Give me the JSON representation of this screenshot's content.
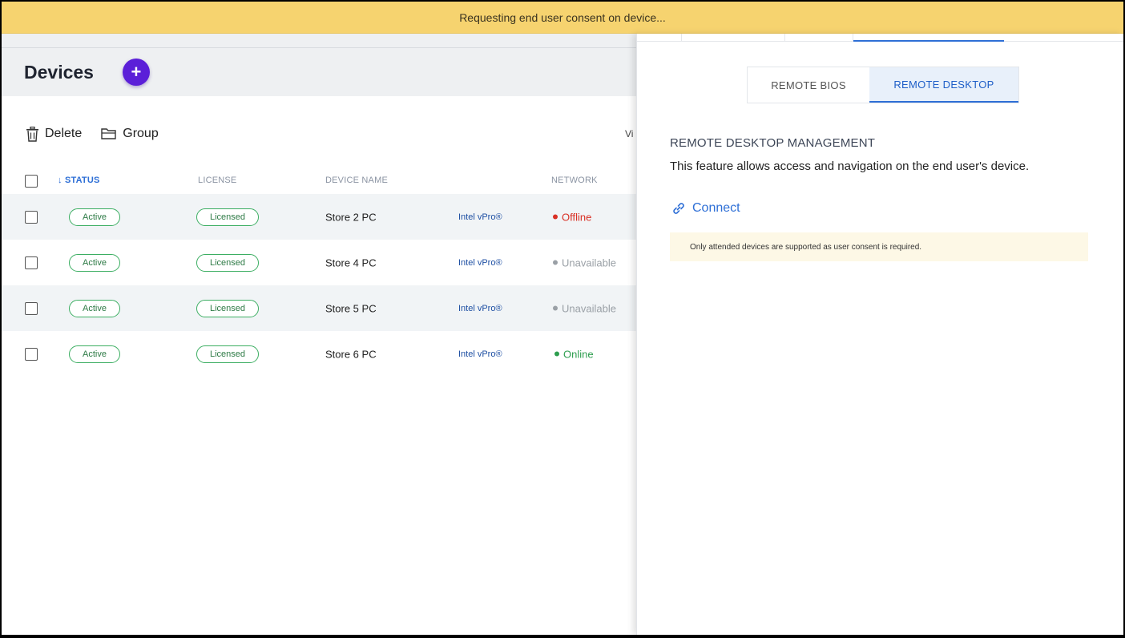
{
  "banner": {
    "text": "Requesting end user consent on device..."
  },
  "page": {
    "title": "Devices",
    "add_label": "+"
  },
  "toolbar": {
    "delete_label": "Delete",
    "group_label": "Group",
    "view_label": "Vi"
  },
  "table": {
    "headers": {
      "status": "STATUS",
      "license": "LICENSE",
      "device_name": "DEVICE NAME",
      "network": "NETWORK"
    },
    "rows": [
      {
        "status": "Active",
        "license": "Licensed",
        "name": "Store 2 PC",
        "tech": "Intel vPro®",
        "network": "Offline",
        "network_color": "#d93025"
      },
      {
        "status": "Active",
        "license": "Licensed",
        "name": "Store 4 PC",
        "tech": "Intel vPro®",
        "network": "Unavailable",
        "network_color": "#9aa0a6"
      },
      {
        "status": "Active",
        "license": "Licensed",
        "name": "Store 5 PC",
        "tech": "Intel vPro®",
        "network": "Unavailable",
        "network_color": "#9aa0a6"
      },
      {
        "status": "Active",
        "license": "Licensed",
        "name": "Store 6 PC",
        "tech": "Intel vPro®",
        "network": "Online",
        "network_color": "#2e9e4f"
      }
    ]
  },
  "drawer": {
    "tabs": {
      "bios": "REMOTE BIOS",
      "desktop": "REMOTE DESKTOP"
    },
    "section_title": "REMOTE DESKTOP MANAGEMENT",
    "section_desc": "This feature allows access and navigation on the end user's device.",
    "connect_label": "Connect",
    "note": "Only attended devices are supported as user consent is required."
  },
  "colors": {
    "banner": "#f6d36f",
    "accent": "#5b1fd8",
    "link": "#2e6fd6",
    "active_pill": "#3cae62"
  }
}
